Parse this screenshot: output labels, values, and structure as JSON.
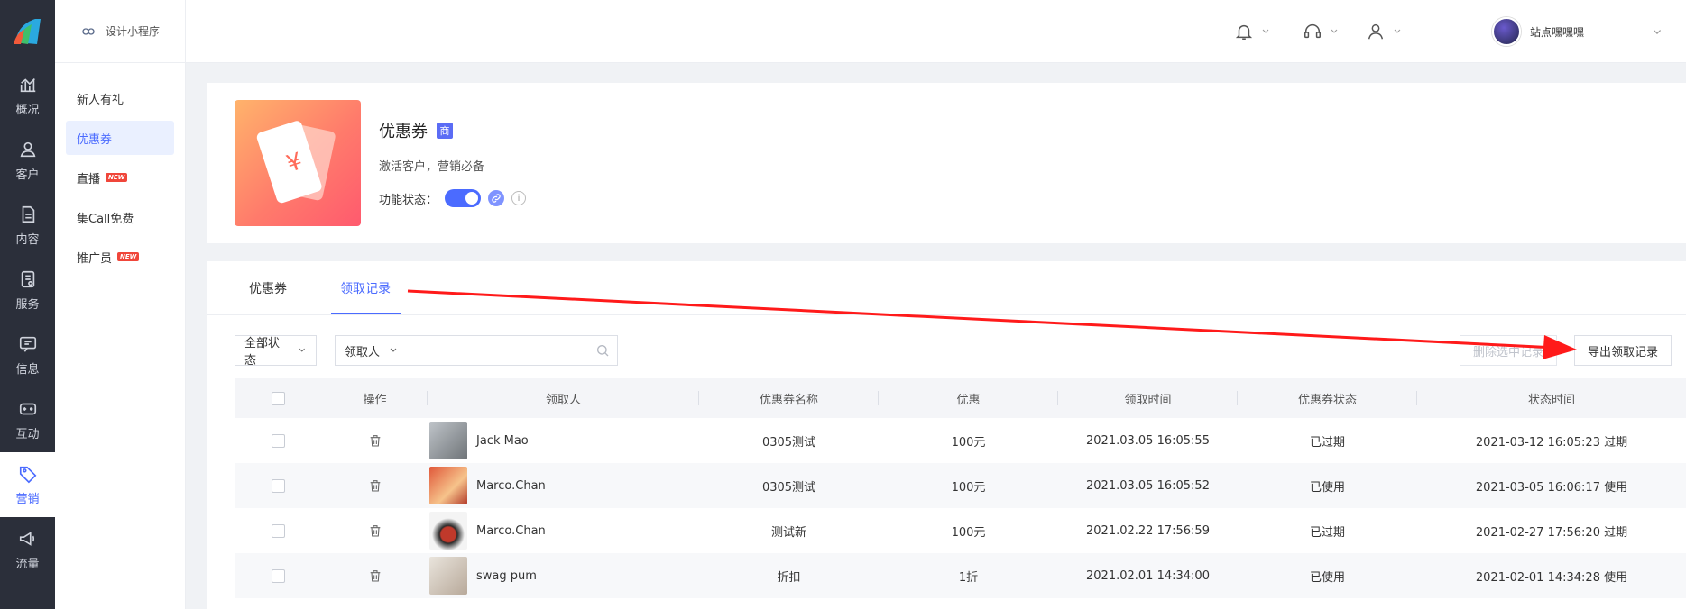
{
  "rail": {
    "items": [
      {
        "label": "概况",
        "icon": "chart-icon"
      },
      {
        "label": "客户",
        "icon": "user-icon"
      },
      {
        "label": "内容",
        "icon": "document-icon"
      },
      {
        "label": "服务",
        "icon": "service-icon"
      },
      {
        "label": "信息",
        "icon": "message-icon"
      },
      {
        "label": "互动",
        "icon": "gamepad-icon"
      },
      {
        "label": "营销",
        "icon": "tag-icon",
        "active": true
      },
      {
        "label": "流量",
        "icon": "megaphone-icon"
      }
    ]
  },
  "subside": {
    "top_label": "设计小程序",
    "items": [
      {
        "label": "新人有礼"
      },
      {
        "label": "优惠券",
        "active": true
      },
      {
        "label": "直播",
        "badge": "NEW"
      },
      {
        "label": "集Call免费"
      },
      {
        "label": "推广员",
        "badge": "NEW"
      }
    ]
  },
  "header": {
    "username": "站点嘿嘿嘿"
  },
  "app": {
    "title": "优惠券",
    "tag": "商",
    "description": "激活客户，营销必备",
    "status_label": "功能状态：",
    "status_on": true,
    "coupon_symbol": "¥"
  },
  "tabs": [
    {
      "label": "优惠券"
    },
    {
      "label": "领取记录",
      "active": true
    }
  ],
  "filters": {
    "status_select": "全部状态",
    "field_select": "领取人",
    "search_placeholder": ""
  },
  "buttons": {
    "delete_selected": "删除选中记录",
    "export": "导出领取记录"
  },
  "table": {
    "columns": [
      "",
      "操作",
      "领取人",
      "优惠券名称",
      "优惠",
      "领取时间",
      "优惠券状态",
      "状态时间"
    ],
    "rows": [
      {
        "name": "Jack Mao",
        "coupon": "0305测试",
        "discount": "100元",
        "time": "2021.03.05 16:05:55",
        "status": "已过期",
        "status_time": "2021-03-12 16:05:23 过期"
      },
      {
        "name": "Marco.Chan",
        "coupon": "0305测试",
        "discount": "100元",
        "time": "2021.03.05 16:05:52",
        "status": "已使用",
        "status_time": "2021-03-05 16:06:17 使用"
      },
      {
        "name": "Marco.Chan",
        "coupon": "测试新",
        "discount": "100元",
        "time": "2021.02.22 17:56:59",
        "status": "已过期",
        "status_time": "2021-02-27 17:56:20 过期"
      },
      {
        "name": "swag pum",
        "coupon": "折扣",
        "discount": "1折",
        "time": "2021.02.01 14:34:00",
        "status": "已使用",
        "status_time": "2021-02-01 14:34:28 使用"
      }
    ]
  },
  "colors": {
    "accent": "#4b6bff",
    "rail_bg": "#2b2f3a",
    "annotation_arrow": "#ff1a1a"
  }
}
